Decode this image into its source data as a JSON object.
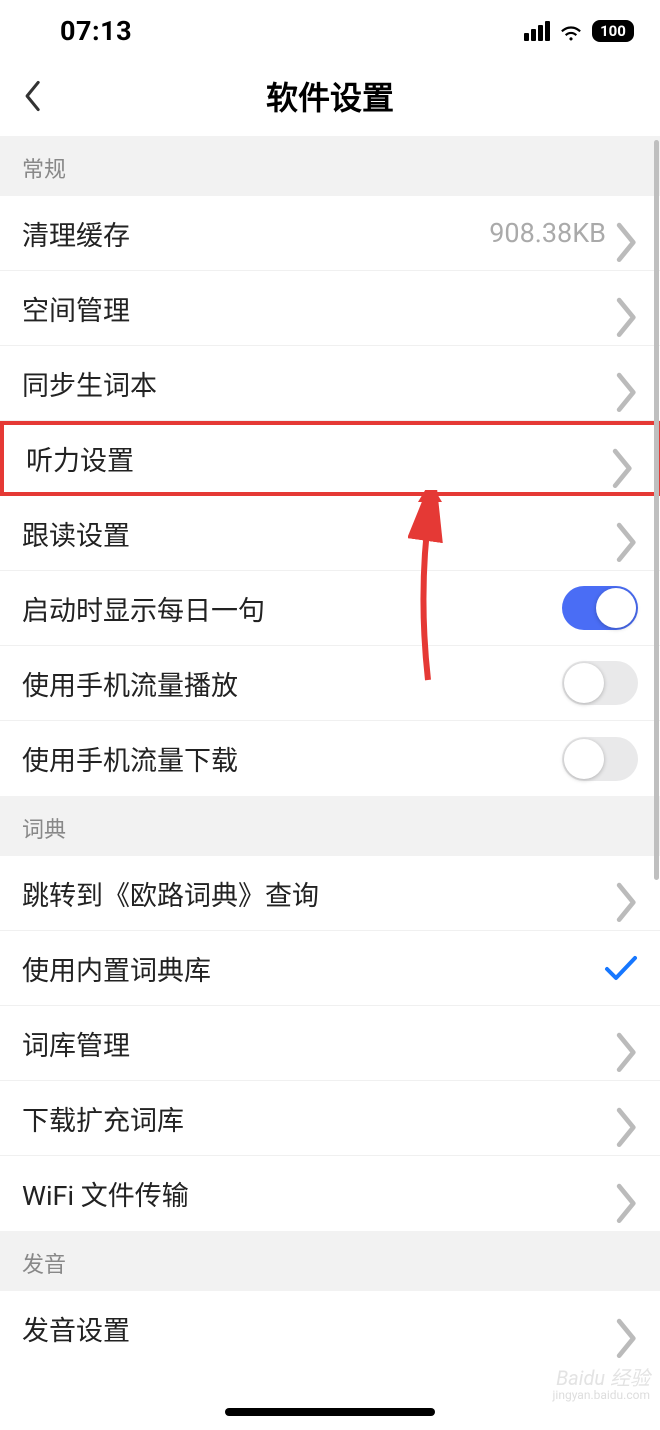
{
  "statusBar": {
    "time": "07:13",
    "battery": "100"
  },
  "header": {
    "title": "软件设置"
  },
  "sections": {
    "general": {
      "header": "常规",
      "items": {
        "clearCache": {
          "label": "清理缓存",
          "value": "908.38KB"
        },
        "spaceMgmt": {
          "label": "空间管理"
        },
        "syncVocab": {
          "label": "同步生词本"
        },
        "listening": {
          "label": "听力设置"
        },
        "followRead": {
          "label": "跟读设置"
        },
        "dailySentence": {
          "label": "启动时显示每日一句"
        },
        "cellularPlay": {
          "label": "使用手机流量播放"
        },
        "cellularDownload": {
          "label": "使用手机流量下载"
        }
      }
    },
    "dict": {
      "header": "词典",
      "items": {
        "jumpEudic": {
          "label": "跳转到《欧路词典》查询"
        },
        "builtinDict": {
          "label": "使用内置词典库"
        },
        "dictMgmt": {
          "label": "词库管理"
        },
        "downloadDict": {
          "label": "下载扩充词库"
        },
        "wifiTransfer": {
          "label": "WiFi 文件传输"
        }
      }
    },
    "pronounce": {
      "header": "发音",
      "items": {
        "pronounceSettings": {
          "label": "发音设置"
        }
      }
    }
  },
  "watermark": {
    "main": "Baidu 经验",
    "sub": "jingyan.baidu.com"
  }
}
